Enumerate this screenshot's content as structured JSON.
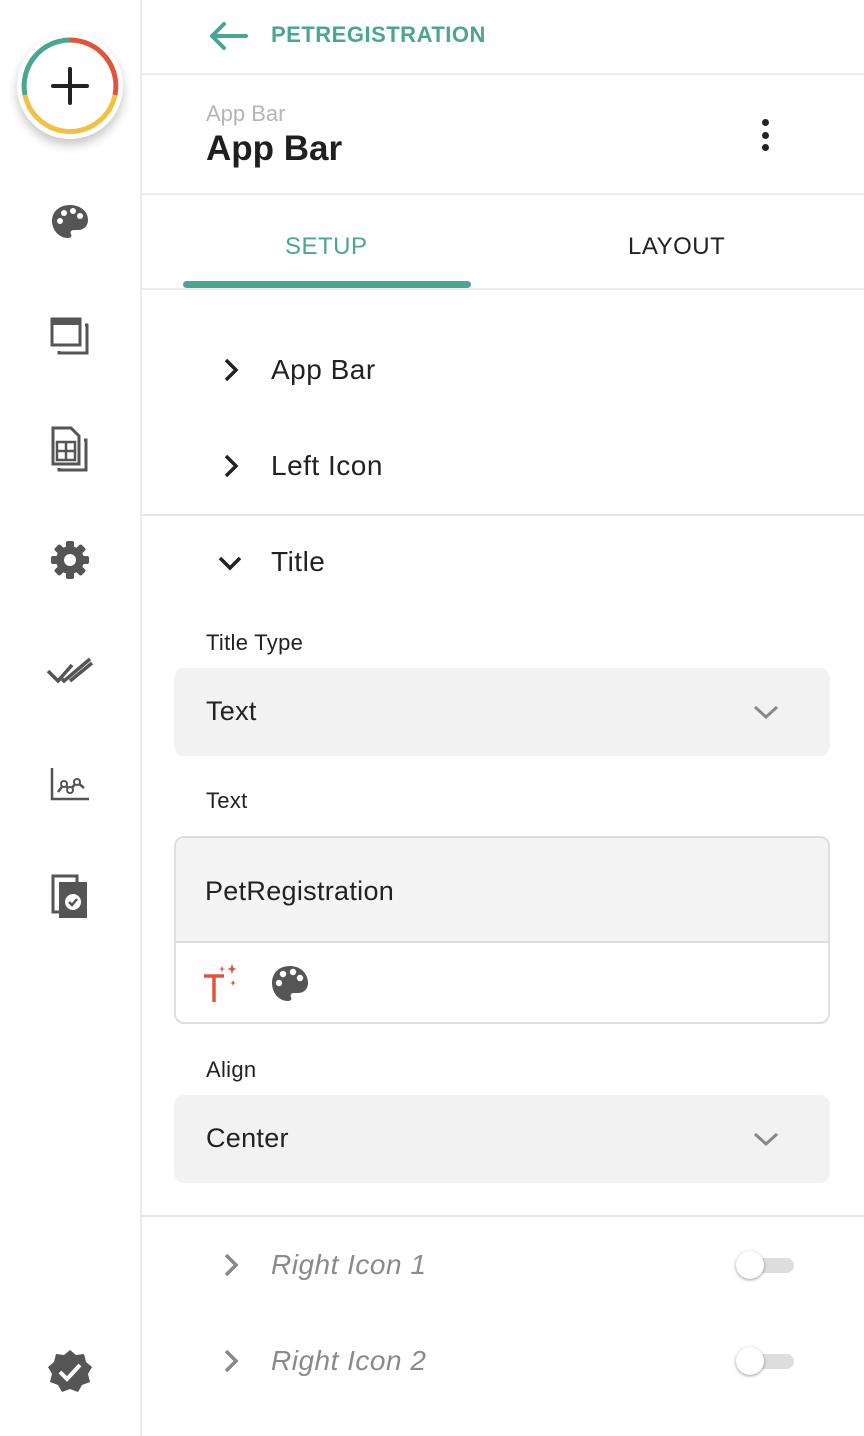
{
  "rail": {
    "items": [
      {
        "icon": "palette-icon"
      },
      {
        "icon": "screens-icon"
      },
      {
        "icon": "data-table-icon"
      },
      {
        "icon": "gear-icon"
      },
      {
        "icon": "double-check-icon"
      },
      {
        "icon": "analytics-icon"
      },
      {
        "icon": "publish-document-icon"
      }
    ],
    "bottom_icon": "verified-badge-icon"
  },
  "topbar": {
    "back_label": "PETREGISTRATION"
  },
  "header": {
    "subtitle": "App Bar",
    "title": "App Bar"
  },
  "tabs": [
    {
      "label": "SETUP",
      "active": true
    },
    {
      "label": "LAYOUT",
      "active": false
    }
  ],
  "sections": {
    "app_bar": "App Bar",
    "left_icon": "Left Icon",
    "title": "Title",
    "right_icon_1": "Right Icon 1",
    "right_icon_2": "Right Icon 2"
  },
  "title_section": {
    "title_type_label": "Title Type",
    "title_type_value": "Text",
    "text_label": "Text",
    "text_value": "PetRegistration",
    "align_label": "Align",
    "align_value": "Center"
  },
  "toggles": {
    "right_icon_1": false,
    "right_icon_2": false
  },
  "colors": {
    "accent": "#4aa592",
    "orange": "#e0553a",
    "yellow": "#f2c044"
  }
}
